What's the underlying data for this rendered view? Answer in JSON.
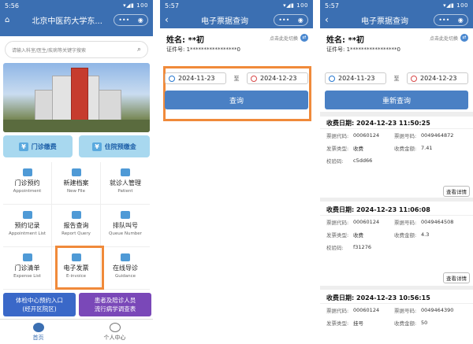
{
  "p1": {
    "time": "5:56",
    "battery": "100",
    "title": "北京中医药大学东...",
    "search_placeholder": "请输入科室/医生/疾病等关键字搜索",
    "pay1": "门诊缴费",
    "pay2": "住院预缴金",
    "grid": [
      {
        "cn": "门诊预约",
        "en": "Appointment"
      },
      {
        "cn": "新建档案",
        "en": "New File"
      },
      {
        "cn": "就诊人管理",
        "en": "Patient"
      },
      {
        "cn": "预约记录",
        "en": "Appointment List"
      },
      {
        "cn": "报告查询",
        "en": "Report Query"
      },
      {
        "cn": "排队叫号",
        "en": "Queue Number"
      },
      {
        "cn": "门诊清单",
        "en": "Expense List"
      },
      {
        "cn": "电子发票",
        "en": "E-invoice"
      },
      {
        "cn": "在线导诊",
        "en": "Guidance"
      }
    ],
    "banner1": "体检中心预约入口\n(经开区院区)",
    "banner2": "患者及陪诊人员\n流行病学调查表",
    "tabs": [
      "首页",
      "个人中心"
    ]
  },
  "p2": {
    "time": "5:57",
    "battery": "100",
    "title": "电子票据查询",
    "name": "姓名: **初",
    "id": "证件号: 1*****************0",
    "switch": "点击此处切换",
    "from": "2024-11-23",
    "to_label": "至",
    "to": "2024-12-23",
    "query": "查询"
  },
  "p3": {
    "time": "5:57",
    "battery": "100",
    "title": "电子票据查询",
    "name": "姓名: **初",
    "id": "证件号: 1*****************0",
    "switch": "点击此处切换",
    "from": "2024-11-23",
    "to_label": "至",
    "to": "2024-12-23",
    "requery": "重新查询",
    "labels": {
      "date": "收费日期:",
      "code": "票据代码:",
      "num": "票据号码:",
      "type": "发票类型:",
      "amount": "收费金额:",
      "check": "校验码:",
      "detail": "查看详情"
    },
    "records": [
      {
        "date": "2024-12-23 11:50:25",
        "code": "00060124",
        "num": "0049464872",
        "type": "收费",
        "amount": "7.41",
        "check": "c5dd66"
      },
      {
        "date": "2024-12-23 11:06:08",
        "code": "00060124",
        "num": "0049464508",
        "type": "收费",
        "amount": "4.3",
        "check": "f31276"
      },
      {
        "date": "2024-12-23 10:56:15",
        "code": "00060124",
        "num": "0049464390",
        "type": "挂号",
        "amount": "50",
        "check": ""
      }
    ]
  }
}
